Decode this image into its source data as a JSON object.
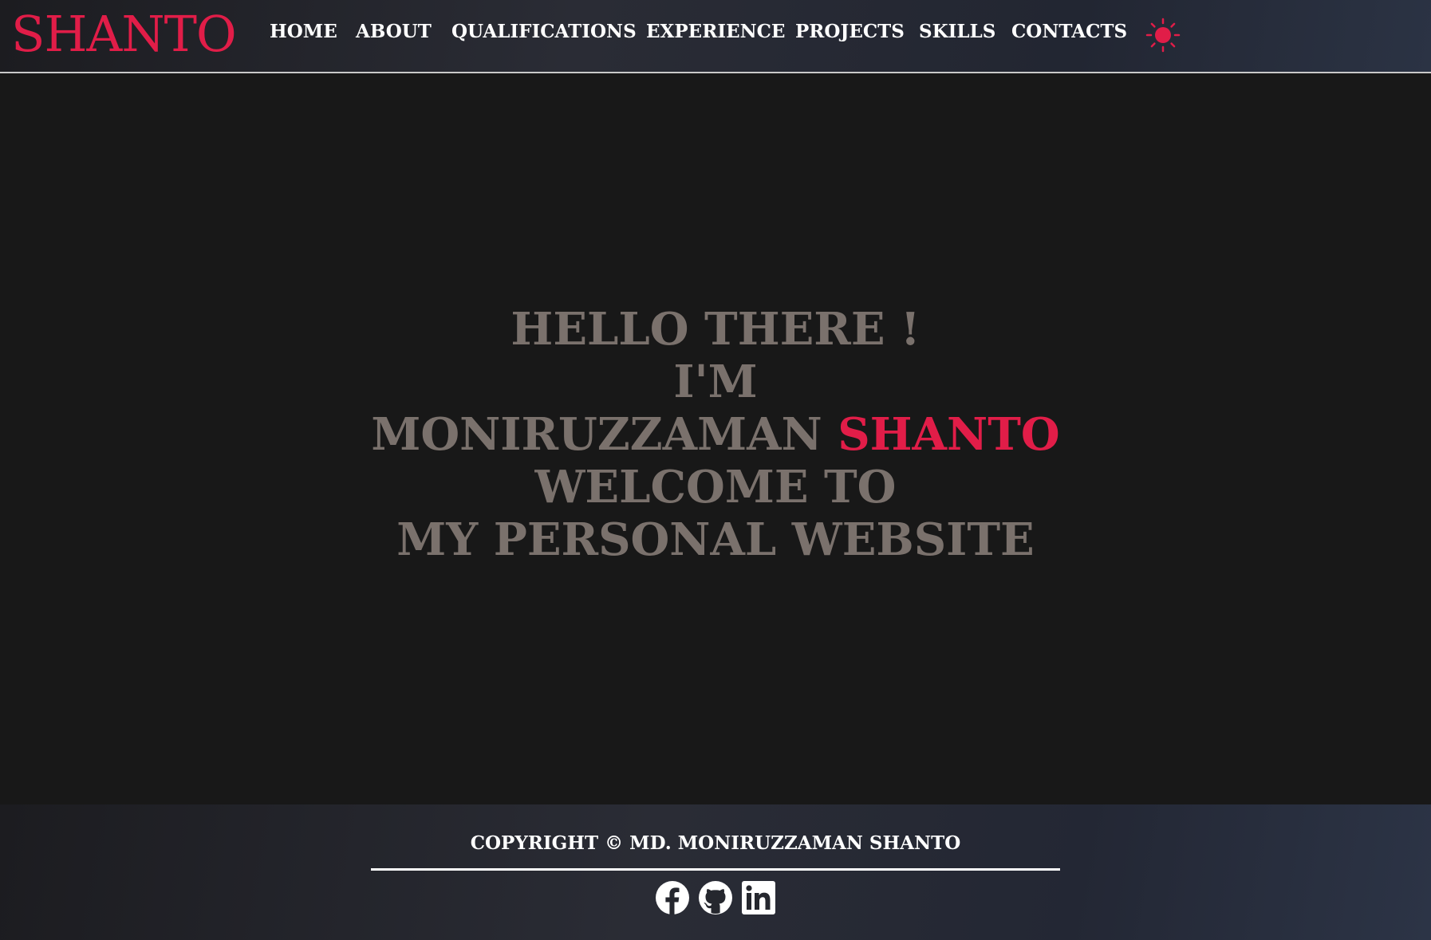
{
  "header": {
    "logo": "SHANTO",
    "nav": [
      "HOME",
      "ABOUT",
      "QUALIFICATIONS",
      "EXPERIENCE",
      "PROJECTS",
      "SKILLS",
      "CONTACTS"
    ],
    "theme_icon": "sun-icon"
  },
  "hero": {
    "line1": "HELLO THERE !",
    "line2": "I'M",
    "line3_name": "MONIRUZZAMAN",
    "line3_accent": "SHANTO",
    "line4": "WELCOME TO",
    "line5": "MY PERSONAL WEBSITE"
  },
  "footer": {
    "copyright": "COPYRIGHT © MD. MONIRUZZAMAN SHANTO",
    "social_icons": [
      "facebook-icon",
      "github-icon",
      "linkedin-icon"
    ]
  },
  "colors": {
    "accent": "#e11d48",
    "hero_text": "#7a716c",
    "background": "#181818"
  }
}
